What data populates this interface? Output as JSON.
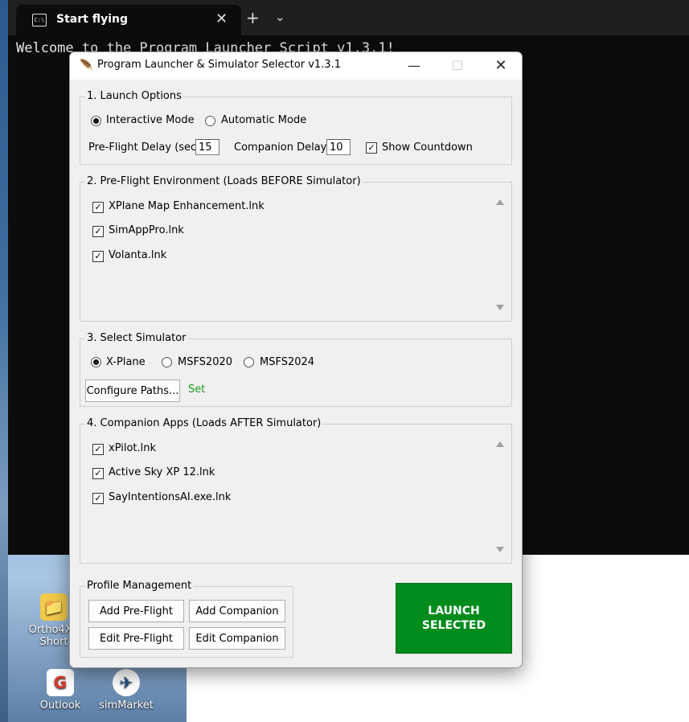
{
  "terminal": {
    "tab_title": "Start flying",
    "tab_icon": "terminal-icon",
    "new_tab_glyph": "+",
    "dropdown_glyph": "⌄",
    "close_glyph": "✕",
    "output_line": "Welcome to the Program Launcher Script v1.3.1!"
  },
  "desktop": {
    "icons": [
      {
        "label": "Ortho4X - Short",
        "icon": "shortcut-icon"
      },
      {
        "label": "Outlook",
        "icon": "outlook-icon"
      },
      {
        "label": "simMarket",
        "icon": "simmarket-icon"
      }
    ]
  },
  "dialog": {
    "title": "Program Launcher & Simulator Selector v1.3.1",
    "window_controls": {
      "minimize": "—",
      "maximize": "☐",
      "close": "✕"
    },
    "launch_options": {
      "title": "1. Launch Options",
      "mode_interactive": "Interactive Mode",
      "mode_automatic": "Automatic Mode",
      "selected_mode": "Interactive Mode",
      "preflight_delay_label": "Pre-Flight Delay (sec):",
      "preflight_delay_value": "15",
      "companion_delay_label": "Companion Delay:",
      "companion_delay_value": "10",
      "show_countdown_label": "Show Countdown",
      "show_countdown_checked": true
    },
    "preflight": {
      "title": "2. Pre-Flight Environment (Loads BEFORE Simulator)",
      "items": [
        {
          "label": "XPlane Map Enhancement.lnk",
          "checked": true
        },
        {
          "label": "SimAppPro.lnk",
          "checked": true
        },
        {
          "label": "Volanta.lnk",
          "checked": true
        }
      ]
    },
    "simulator": {
      "title": "3. Select Simulator",
      "options": [
        "X-Plane",
        "MSFS2020",
        "MSFS2024"
      ],
      "selected": "X-Plane",
      "configure_label": "Configure Paths...",
      "status_text": "Set",
      "status_color": "#1a9b1a"
    },
    "companion": {
      "title": "4. Companion Apps (Loads AFTER Simulator)",
      "items": [
        {
          "label": "xPilot.lnk",
          "checked": true
        },
        {
          "label": "Active Sky XP 12.lnk",
          "checked": true
        },
        {
          "label": "SayIntentionsAI.exe.lnk",
          "checked": true
        }
      ]
    },
    "profile": {
      "title": "Profile Management",
      "add_preflight": "Add Pre-Flight",
      "add_companion": "Add Companion",
      "edit_preflight": "Edit Pre-Flight",
      "edit_companion": "Edit Companion"
    },
    "launch_line1": "LAUNCH",
    "launch_line2": "SELECTED",
    "launch_color": "#008c1d"
  }
}
